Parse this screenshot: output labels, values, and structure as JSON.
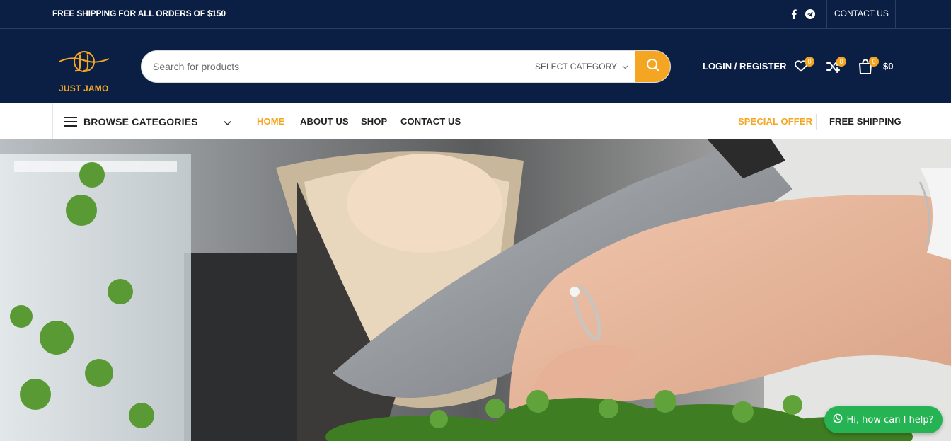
{
  "topbar": {
    "promo": "FREE SHIPPING FOR ALL ORDERS OF $150",
    "social": [
      "facebook-icon",
      "telegram-icon"
    ],
    "contact_label": "CONTACT US"
  },
  "header": {
    "logo_text": "JUST JAMO",
    "search_placeholder": "Search for products",
    "category_label": "SELECT CATEGORY",
    "login_label": "LOGIN / REGISTER",
    "wishlist_count": "0",
    "compare_count": "0",
    "cart_count": "0",
    "cart_total": "$0"
  },
  "nav": {
    "browse_label": "BROWSE CATEGORIES",
    "links": [
      {
        "label": "HOME",
        "active": true
      },
      {
        "label": "ABOUT US",
        "active": false
      },
      {
        "label": "SHOP",
        "active": false
      },
      {
        "label": "CONTACT US",
        "active": false
      }
    ],
    "special_offer": "SPECIAL OFFER",
    "free_shipping": "FREE SHIPPING"
  },
  "chat": {
    "label": "Hi, how can I help?"
  },
  "colors": {
    "navy": "#0b1f45",
    "accent": "#f4a622",
    "whatsapp": "#25b353"
  }
}
